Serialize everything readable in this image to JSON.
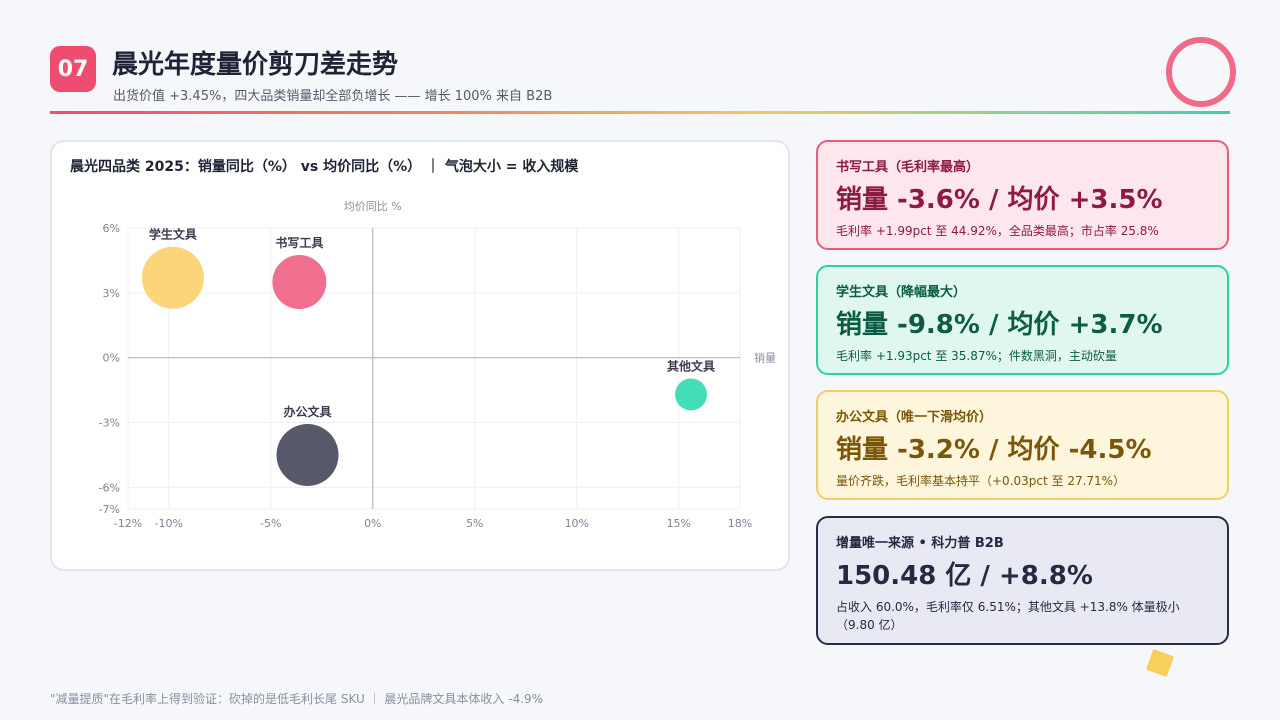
{
  "header": {
    "badge": "07",
    "title": "晨光年度量价剪刀差走势",
    "subtitle": "出货价值 +3.45%，四大品类销量却全部负增长 —— 增长 100% 来自 B2B"
  },
  "chart_data": {
    "type": "scatter",
    "title": "晨光四品类 2025：销量同比（%） vs 均价同比（%） ｜ 气泡大小 = 收入规模",
    "xlabel": "销量",
    "ylabel": "均价同比 %",
    "xlim": [
      -12,
      18
    ],
    "ylim": [
      -7,
      6
    ],
    "x_ticks": [
      -12,
      -10,
      -5,
      0,
      5,
      10,
      15,
      18
    ],
    "x_tick_labels": [
      "-12%",
      "-10%",
      "-5%",
      "0%",
      "5%",
      "10%",
      "15%",
      "18%"
    ],
    "y_ticks": [
      -7,
      -6,
      -3,
      0,
      3,
      6
    ],
    "y_tick_labels": [
      "-7%",
      "-6%",
      "-3%",
      "0%",
      "3%",
      "6%"
    ],
    "grid": true,
    "points": [
      {
        "name": "学生文具",
        "x": -9.8,
        "y": 3.7,
        "size": 31,
        "color": "#fcd06f"
      },
      {
        "name": "书写工具",
        "x": -3.6,
        "y": 3.5,
        "size": 27,
        "color": "#ef6386"
      },
      {
        "name": "办公文具",
        "x": -3.2,
        "y": -4.5,
        "size": 31,
        "color": "#4a4a5e"
      },
      {
        "name": "其他文具",
        "x": 15.6,
        "y": -1.7,
        "size": 16,
        "color": "#34dbb0"
      }
    ]
  },
  "cards": [
    {
      "key": "书写工具（毛利率最高）",
      "value": "销量 -3.6% / 均价 +3.5%",
      "desc": "毛利率 +1.99pct 至 44.92%，全品类最高；市占率 25.8%"
    },
    {
      "key": "学生文具（降幅最大）",
      "value": "销量 -9.8% / 均价 +3.7%",
      "desc": "毛利率 +1.93pct 至 35.87%；件数黑洞，主动砍量"
    },
    {
      "key": "办公文具（唯一下滑均价）",
      "value": "销量 -3.2% / 均价 -4.5%",
      "desc": "量价齐跌，毛利率基本持平（+0.03pct 至 27.71%）"
    },
    {
      "key": "增量唯一来源 • 科力普 B2B",
      "value": "150.48 亿 / +8.8%",
      "desc": "占收入 60.0%，毛利率仅 6.51%；其他文具 +13.8% 体量极小（9.80 亿）"
    }
  ],
  "footer": "\"减量提质\"在毛利率上得到验证：砍掉的是低毛利长尾 SKU ｜ 晨光品牌文具本体收入 -4.9%"
}
